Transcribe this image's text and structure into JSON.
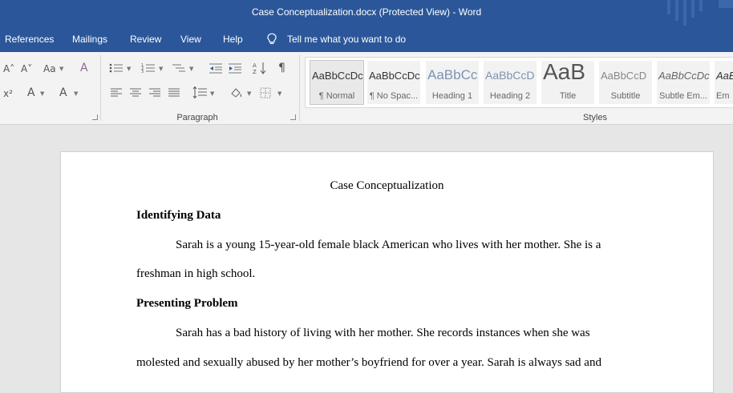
{
  "window": {
    "title": "Case Conceptualization.docx (Protected View)  -  Word"
  },
  "tabs": [
    {
      "label": "References"
    },
    {
      "label": "Mailings"
    },
    {
      "label": "Review"
    },
    {
      "label": "View"
    },
    {
      "label": "Help"
    }
  ],
  "tellme": {
    "label": "Tell me what you want to do",
    "icon": "lightbulb-icon"
  },
  "ribbon": {
    "font_group": {
      "grow_font": "A˄",
      "shrink_font": "A˅",
      "change_case": "Aa",
      "clear_formatting": "A",
      "superscript": "x²",
      "text_effects": "A",
      "font_color": "A"
    },
    "paragraph_group": {
      "label": "Paragraph",
      "pilcrow": "¶"
    },
    "styles_group": {
      "label": "Styles",
      "styles": [
        {
          "preview": "AaBbCcDc",
          "name": "¶ Normal"
        },
        {
          "preview": "AaBbCcDc",
          "name": "¶ No Spac..."
        },
        {
          "preview": "AaBbCc",
          "name": "Heading 1"
        },
        {
          "preview": "AaBbCcD",
          "name": "Heading 2"
        },
        {
          "preview": "AaB",
          "name": "Title"
        },
        {
          "preview": "AaBbCcD",
          "name": "Subtitle"
        },
        {
          "preview": "AaBbCcDc",
          "name": "Subtle Em..."
        },
        {
          "preview": "AaBb",
          "name": "Em"
        }
      ]
    }
  },
  "document": {
    "title": "Case Conceptualization",
    "sections": [
      {
        "heading": "Identifying Data",
        "lines": [
          "Sarah is a young 15-year-old female black American who lives with her mother. She is a",
          "freshman in high school."
        ]
      },
      {
        "heading": "Presenting Problem",
        "lines": [
          "Sarah has a bad history of living with her mother. She records instances when she was",
          "molested and sexually abused by her mother’s boyfriend for over a year. Sarah is always sad and"
        ]
      }
    ]
  },
  "colors": {
    "word_blue": "#2b579a",
    "ribbon_bg": "#f3f3f3",
    "canvas_bg": "#e6e6e6"
  }
}
